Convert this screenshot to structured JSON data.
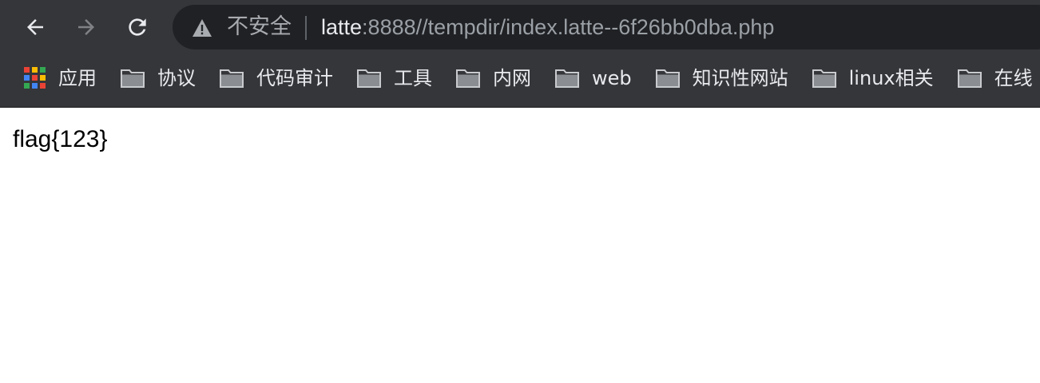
{
  "toolbar": {
    "security_label": "不安全",
    "url_host": "latte",
    "url_rest": ":8888//tempdir/index.latte--6f26bb0dba.php"
  },
  "bookmarks": [
    {
      "label": "应用",
      "icon": "apps-grid-icon"
    },
    {
      "label": "协议",
      "icon": "folder-icon"
    },
    {
      "label": "代码审计",
      "icon": "folder-icon"
    },
    {
      "label": "工具",
      "icon": "folder-icon"
    },
    {
      "label": "内网",
      "icon": "folder-icon"
    },
    {
      "label": "web",
      "icon": "folder-icon"
    },
    {
      "label": "知识性网站",
      "icon": "folder-icon"
    },
    {
      "label": "linux相关",
      "icon": "folder-icon"
    },
    {
      "label": "在线",
      "icon": "folder-icon"
    }
  ],
  "page": {
    "body_text": "flag{123}"
  },
  "colors": {
    "chrome_bg": "#35363a",
    "omnibox_bg": "#202124",
    "page_bg": "#ffffff"
  }
}
